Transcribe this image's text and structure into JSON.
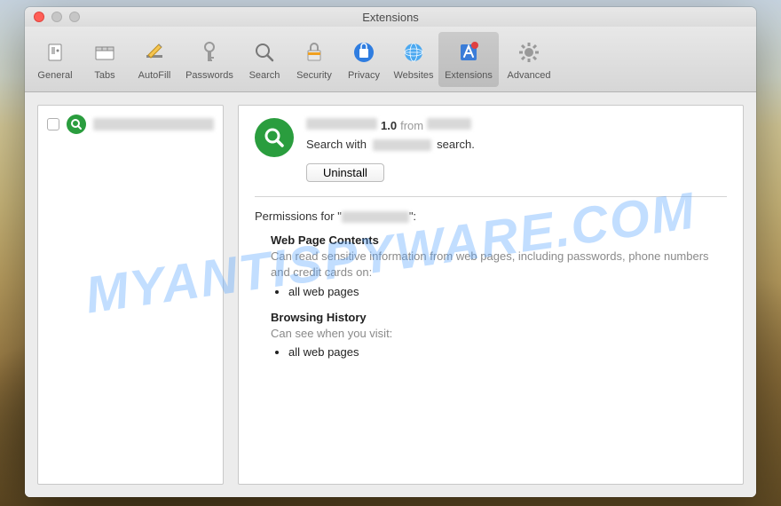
{
  "window": {
    "title": "Extensions"
  },
  "toolbar": {
    "items": [
      {
        "label": "General"
      },
      {
        "label": "Tabs"
      },
      {
        "label": "AutoFill"
      },
      {
        "label": "Passwords"
      },
      {
        "label": "Search"
      },
      {
        "label": "Security"
      },
      {
        "label": "Privacy"
      },
      {
        "label": "Websites"
      },
      {
        "label": "Extensions"
      },
      {
        "label": "Advanced"
      }
    ],
    "selected_index": 8
  },
  "sidebar": {
    "extensions": [
      {
        "checked": false
      }
    ]
  },
  "detail": {
    "version": "1.0",
    "from_label": "from",
    "description_prefix": "Search with",
    "description_suffix": "search.",
    "uninstall_label": "Uninstall",
    "permissions_prefix": "Permissions for \"",
    "permissions_suffix": "\":",
    "sections": [
      {
        "heading": "Web Page Contents",
        "desc": "Can read sensitive information from web pages, including passwords, phone numbers and credit cards on:",
        "items": [
          "all web pages"
        ]
      },
      {
        "heading": "Browsing History",
        "desc": "Can see when you visit:",
        "items": [
          "all web pages"
        ]
      }
    ]
  },
  "watermark": "MYANTISPYWARE.COM"
}
